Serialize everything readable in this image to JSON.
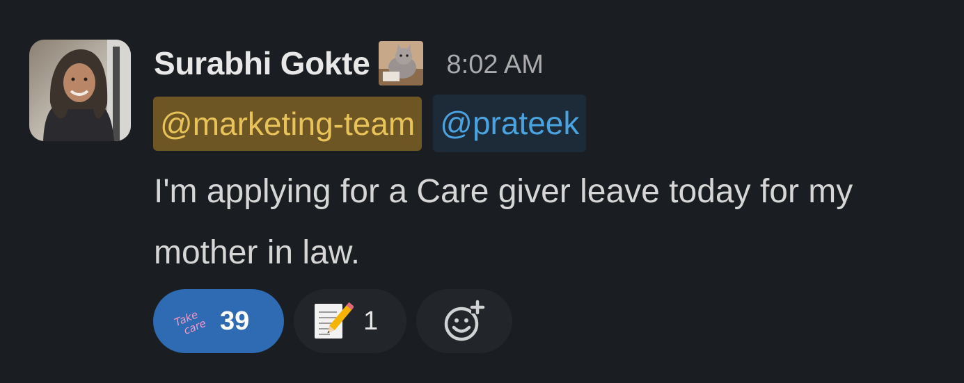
{
  "message": {
    "sender_name": "Surabhi Gokte",
    "timestamp": "8:02 AM",
    "mentions": {
      "group": "@marketing-team",
      "user": "@prateek"
    },
    "body": "I'm applying for a Care giver leave today for my mother in law."
  },
  "reactions": [
    {
      "emoji": "take-care-custom-emoji",
      "emoji_text_line1": "Take",
      "emoji_text_line2": "care",
      "count": "39",
      "active": true
    },
    {
      "emoji": "memo-icon",
      "count": "1",
      "active": false
    },
    {
      "emoji": "add-reaction-icon"
    }
  ],
  "colors": {
    "background": "#1a1d21",
    "group_mention_bg": "#6e5524",
    "group_mention_text": "#e8c35a",
    "user_mention_bg": "#1d2b38",
    "user_mention_text": "#4aa3df",
    "active_reaction_bg": "#2e6bb3",
    "reaction_bg": "#222529"
  }
}
